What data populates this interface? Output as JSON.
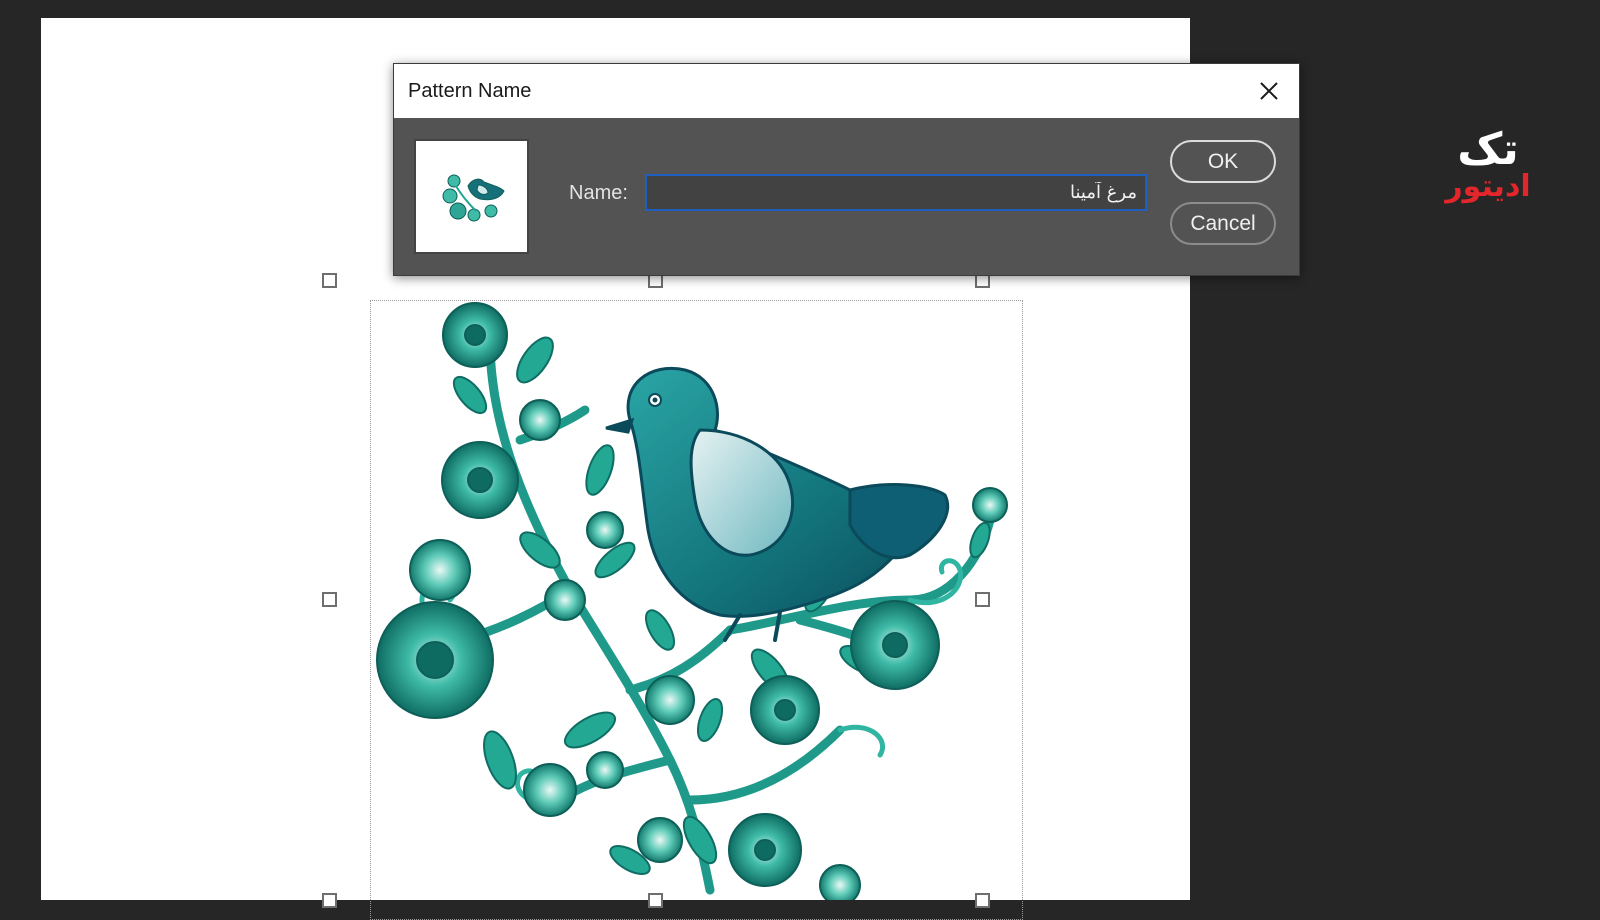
{
  "dialog": {
    "title": "Pattern Name",
    "close_icon": "close-icon",
    "name_label": "Name:",
    "name_value": "مرغ آمینا",
    "ok_label": "OK",
    "cancel_label": "Cancel",
    "thumbnail_icon": "bird-pattern-thumbnail"
  },
  "watermark": {
    "line1": "تک",
    "line2": "ادیتور",
    "line2_color": "#e2262b"
  },
  "canvas": {
    "artwork": "embroidered-bird-illustration",
    "selection": "transform-bounding-box"
  },
  "colors": {
    "teal_dark": "#0f5e64",
    "teal": "#23a59a",
    "teal_light": "#7fd6c8",
    "workspace": "#262626",
    "dialog_body": "#535353",
    "input_focus": "#1f5fbf"
  }
}
